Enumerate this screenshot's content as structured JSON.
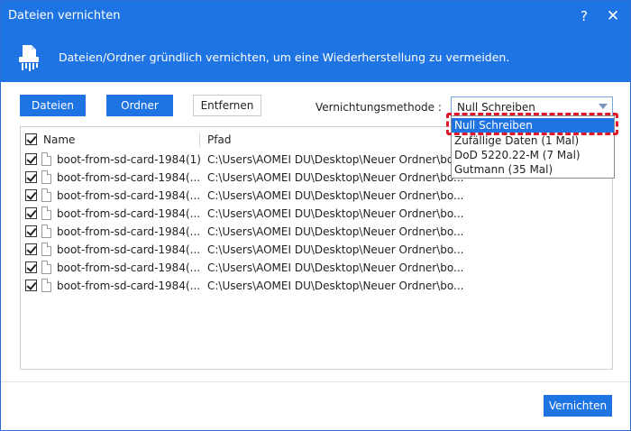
{
  "window": {
    "title": "Dateien vernichten",
    "help_label": "?",
    "close_label": "✕"
  },
  "banner": {
    "icon": "shredder-icon",
    "text": "Dateien/Ordner gründlich vernichten, um eine Wiederherstellung zu vermeiden."
  },
  "toolbar": {
    "dateien_label": "Dateien",
    "ordner_label": "Ordner",
    "entfernen_label": "Entfernen"
  },
  "method": {
    "label": "Vernichtungsmethode :",
    "selected": "Null Schreiben",
    "options": [
      "Null Schreiben",
      "Zufällige Daten (1 Mal)",
      "DoD 5220.22-M (7 Mal)",
      "Gutmann (35 Mal)"
    ]
  },
  "table": {
    "columns": {
      "name": "Name",
      "path": "Pfad"
    },
    "rows": [
      {
        "name": "boot-from-sd-card-1984(1)",
        "path": "C:\\Users\\AOMEI DU\\Desktop\\Neuer Ordner\\bo..."
      },
      {
        "name": "boot-from-sd-card-1984(...",
        "path": "C:\\Users\\AOMEI DU\\Desktop\\Neuer Ordner\\bo..."
      },
      {
        "name": "boot-from-sd-card-1984(...",
        "path": "C:\\Users\\AOMEI DU\\Desktop\\Neuer Ordner\\bo..."
      },
      {
        "name": "boot-from-sd-card-1984(...",
        "path": "C:\\Users\\AOMEI DU\\Desktop\\Neuer Ordner\\bo..."
      },
      {
        "name": "boot-from-sd-card-1984(...",
        "path": "C:\\Users\\AOMEI DU\\Desktop\\Neuer Ordner\\bo..."
      },
      {
        "name": "boot-from-sd-card-1984(...",
        "path": "C:\\Users\\AOMEI DU\\Desktop\\Neuer Ordner\\bo..."
      },
      {
        "name": "boot-from-sd-card-1984(...",
        "path": "C:\\Users\\AOMEI DU\\Desktop\\Neuer Ordner\\bo..."
      },
      {
        "name": "boot-from-sd-card-1984(...",
        "path": "C:\\Users\\AOMEI DU\\Desktop\\Neuer Ordner\\bo..."
      }
    ]
  },
  "footer": {
    "vernichten_label": "Vernichten"
  },
  "colors": {
    "accent": "#1f74e3",
    "highlight": "#e0182a"
  }
}
